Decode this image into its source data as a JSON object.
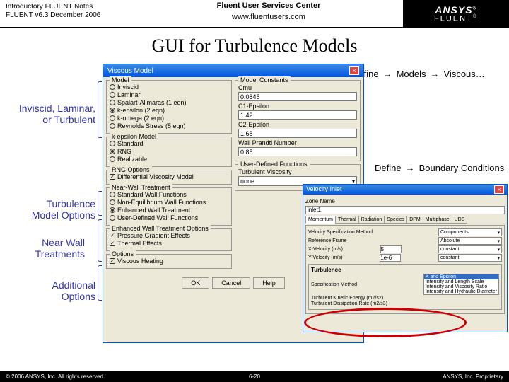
{
  "header": {
    "left1": "Introductory FLUENT Notes",
    "left2": "FLUENT v6.3 December 2006",
    "center1": "Fluent User Services Center",
    "center2": "www.fluentusers.com",
    "brand1": "ANSYS",
    "brand2": "FLUENT"
  },
  "title": "GUI for Turbulence Models",
  "labels": {
    "l1a": "Inviscid, Laminar,",
    "l1b": "or Turbulent",
    "l2a": "Turbulence",
    "l2b": "Model Options",
    "l3a": "Near Wall",
    "l3b": "Treatments",
    "l4a": "Additional",
    "l4b": "Options"
  },
  "crumbs": {
    "define": "Define",
    "models": "Models",
    "viscous": "Viscous…",
    "bc": "Boundary Conditions"
  },
  "vm": {
    "title": "Viscous Model",
    "grpModel": "Model",
    "models": [
      "Inviscid",
      "Laminar",
      "Spalart-Allmaras (1 eqn)",
      "k-epsilon (2 eqn)",
      "k-omega (2 eqn)",
      "Reynolds Stress (5 eqn)"
    ],
    "grpKeps": "k-epsilon Model",
    "keps": [
      "Standard",
      "RNG",
      "Realizable"
    ],
    "grpRng": "RNG Options",
    "rng": "Differential Viscosity Model",
    "grpWall": "Near-Wall Treatment",
    "wall": [
      "Standard Wall Functions",
      "Non-Equilibrium Wall Functions",
      "Enhanced Wall Treatment",
      "User-Defined Wall Functions"
    ],
    "grpEwt": "Enhanced Wall Treatment Options",
    "ewt": [
      "Pressure Gradient Effects",
      "Thermal Effects"
    ],
    "grpOpt": "Options",
    "opt": "Viscous Heating",
    "grpConst": "Model Constants",
    "cmu": "Cmu",
    "cmuV": "0.0845",
    "c1": "C1-Epsilon",
    "c1V": "1.42",
    "c2": "C2-Epsilon",
    "c2V": "1.68",
    "wpn": "Wall Prandtl Number",
    "wpnV": "0.85",
    "grpUdf": "User-Defined Functions",
    "tv": "Turbulent Viscosity",
    "none": "none",
    "ok": "OK",
    "cancel": "Cancel",
    "help": "Help"
  },
  "vi": {
    "title": "Velocity Inlet",
    "zoneName": "Zone Name",
    "zone": "inlet1",
    "tabs": [
      "Momentum",
      "Thermal",
      "Radiation",
      "Species",
      "DPM",
      "Multiphase",
      "UDS"
    ],
    "vsm": "Velocity Specification Method",
    "vsmV": "Components",
    "rf": "Reference Frame",
    "rfV": "Absolute",
    "xv": "X-Velocity (m/s)",
    "xvV": "5",
    "const": "constant",
    "yv": "Y-Velocity (m/s)",
    "yvV": "1e-6",
    "turb": "Turbulence",
    "sm": "Specification Method",
    "smOpts": [
      "K and Epsilon",
      "Intensity and Length Scale",
      "Intensity and Viscosity Ratio",
      "Intensity and Hydraulic Diameter"
    ],
    "tke": "Turbulent Kinetic Energy (m2/s2)",
    "tdr": "Turbulent Dissipation Rate (m2/s3)"
  },
  "footer": {
    "left": "© 2006 ANSYS, Inc. All rights reserved.",
    "center": "6-20",
    "right": "ANSYS, Inc. Proprietary"
  }
}
